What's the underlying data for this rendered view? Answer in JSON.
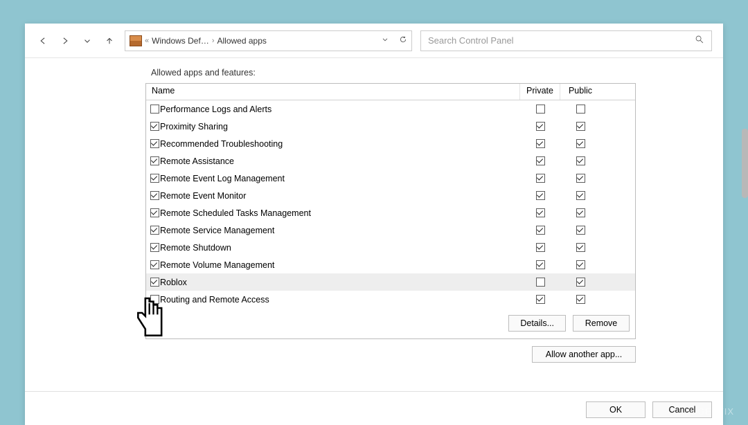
{
  "toolbar": {
    "breadcrumb_prefix": "«",
    "breadcrumb_part1": "Windows Def…",
    "breadcrumb_part2": "Allowed apps",
    "search_placeholder": "Search Control Panel"
  },
  "section": {
    "title": "Allowed apps and features:",
    "col_name": "Name",
    "col_private": "Private",
    "col_public": "Public"
  },
  "apps": [
    {
      "name": "Performance Logs and Alerts",
      "enabled": false,
      "private": false,
      "public": false,
      "selected": false
    },
    {
      "name": "Proximity Sharing",
      "enabled": true,
      "private": true,
      "public": true,
      "selected": false
    },
    {
      "name": "Recommended Troubleshooting",
      "enabled": true,
      "private": true,
      "public": true,
      "selected": false
    },
    {
      "name": "Remote Assistance",
      "enabled": true,
      "private": true,
      "public": true,
      "selected": false
    },
    {
      "name": "Remote Event Log Management",
      "enabled": true,
      "private": true,
      "public": true,
      "selected": false
    },
    {
      "name": "Remote Event Monitor",
      "enabled": true,
      "private": true,
      "public": true,
      "selected": false
    },
    {
      "name": "Remote Scheduled Tasks Management",
      "enabled": true,
      "private": true,
      "public": true,
      "selected": false
    },
    {
      "name": "Remote Service Management",
      "enabled": true,
      "private": true,
      "public": true,
      "selected": false
    },
    {
      "name": "Remote Shutdown",
      "enabled": true,
      "private": true,
      "public": true,
      "selected": false
    },
    {
      "name": "Remote Volume Management",
      "enabled": true,
      "private": true,
      "public": true,
      "selected": false
    },
    {
      "name": "Roblox",
      "enabled": true,
      "private": false,
      "public": true,
      "selected": true
    },
    {
      "name": "Routing and Remote Access",
      "enabled": false,
      "private": true,
      "public": true,
      "selected": false
    }
  ],
  "buttons": {
    "details": "Details...",
    "remove": "Remove",
    "allow_another": "Allow another app...",
    "ok": "OK",
    "cancel": "Cancel"
  },
  "watermark": "UGETFIX"
}
